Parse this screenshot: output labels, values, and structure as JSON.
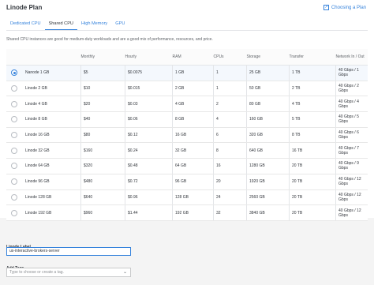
{
  "panel": {
    "title": "Linode Plan",
    "help_link": "Choosing a Plan",
    "tabs": [
      "Dedicated CPU",
      "Shared CPU",
      "High Memory",
      "GPU"
    ],
    "active_tab": "Shared CPU",
    "description": "Shared CPU instances are good for medium-duty workloads and are a good mix of performance, resources, and price."
  },
  "table": {
    "headers": [
      "",
      "Monthly",
      "Hourly",
      "RAM",
      "CPUs",
      "Storage",
      "Transfer",
      "Network In / Out"
    ],
    "rows": [
      {
        "plan": "Nanode 1 GB",
        "monthly": "$5",
        "hourly": "$0.0075",
        "ram": "1 GB",
        "cpus": "1",
        "storage": "25 GB",
        "transfer": "1 TB",
        "net": "40 Gbps / 1 Gbps",
        "selected": true
      },
      {
        "plan": "Linode 2 GB",
        "monthly": "$10",
        "hourly": "$0.015",
        "ram": "2 GB",
        "cpus": "1",
        "storage": "50 GB",
        "transfer": "2 TB",
        "net": "40 Gbps / 2 Gbps",
        "selected": false
      },
      {
        "plan": "Linode 4 GB",
        "monthly": "$20",
        "hourly": "$0.03",
        "ram": "4 GB",
        "cpus": "2",
        "storage": "80 GB",
        "transfer": "4 TB",
        "net": "40 Gbps / 4 Gbps",
        "selected": false
      },
      {
        "plan": "Linode 8 GB",
        "monthly": "$40",
        "hourly": "$0.06",
        "ram": "8 GB",
        "cpus": "4",
        "storage": "160 GB",
        "transfer": "5 TB",
        "net": "40 Gbps / 5 Gbps",
        "selected": false
      },
      {
        "plan": "Linode 16 GB",
        "monthly": "$80",
        "hourly": "$0.12",
        "ram": "16 GB",
        "cpus": "6",
        "storage": "320 GB",
        "transfer": "8 TB",
        "net": "40 Gbps / 6 Gbps",
        "selected": false
      },
      {
        "plan": "Linode 32 GB",
        "monthly": "$160",
        "hourly": "$0.24",
        "ram": "32 GB",
        "cpus": "8",
        "storage": "640 GB",
        "transfer": "16 TB",
        "net": "40 Gbps / 7 Gbps",
        "selected": false
      },
      {
        "plan": "Linode 64 GB",
        "monthly": "$320",
        "hourly": "$0.48",
        "ram": "64 GB",
        "cpus": "16",
        "storage": "1280 GB",
        "transfer": "20 TB",
        "net": "40 Gbps / 9 Gbps",
        "selected": false
      },
      {
        "plan": "Linode 96 GB",
        "monthly": "$480",
        "hourly": "$0.72",
        "ram": "96 GB",
        "cpus": "20",
        "storage": "1920 GB",
        "transfer": "20 TB",
        "net": "40 Gbps / 12 Gbps",
        "selected": false
      },
      {
        "plan": "Linode 128 GB",
        "monthly": "$640",
        "hourly": "$0.96",
        "ram": "128 GB",
        "cpus": "24",
        "storage": "2560 GB",
        "transfer": "20 TB",
        "net": "40 Gbps / 12 Gbps",
        "selected": false
      },
      {
        "plan": "Linode 192 GB",
        "monthly": "$960",
        "hourly": "$1.44",
        "ram": "192 GB",
        "cpus": "32",
        "storage": "3840 GB",
        "transfer": "20 TB",
        "net": "40 Gbps / 12 Gbps",
        "selected": false
      }
    ]
  },
  "form": {
    "label_title": "Linode Label",
    "label_value": "us-interactive-brokers-server",
    "tags_title": "Add Tags",
    "tags_placeholder": "Type to choose or create a tag."
  }
}
